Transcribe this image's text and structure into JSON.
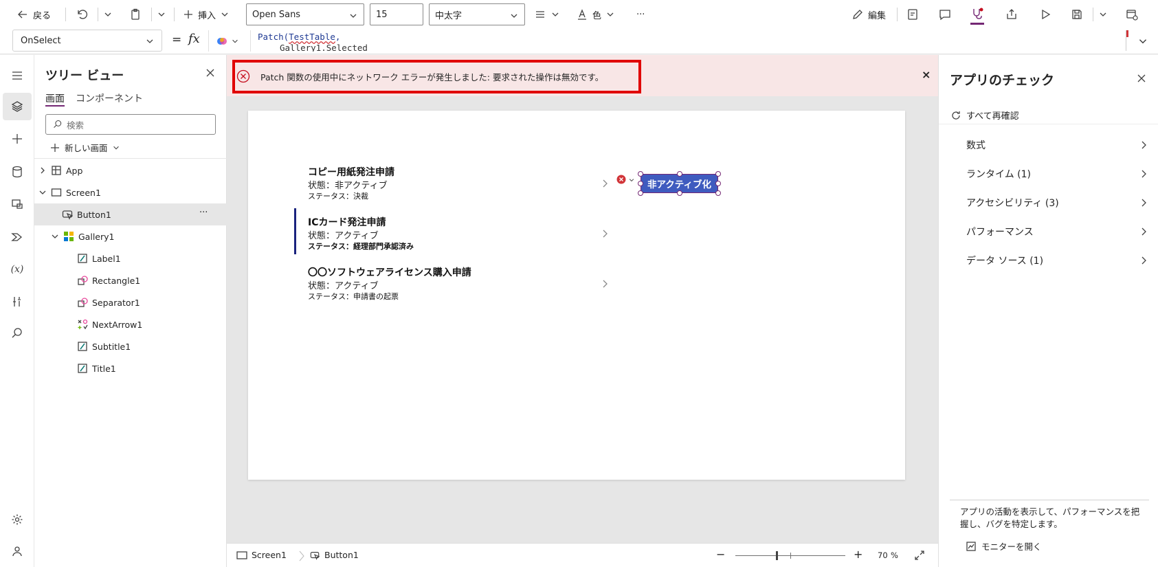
{
  "toolbar": {
    "back_label": "戻る",
    "insert_label": "挿入",
    "font_name": "Open Sans",
    "font_size": "15",
    "font_weight": "中太字",
    "color_label": "色",
    "more_label": "···",
    "edit_label": "編集"
  },
  "formula": {
    "property": "OnSelect",
    "equals": "=",
    "fx": "fx",
    "line1_fn": "Patch(",
    "line1_arg": "TestTable",
    "line1_comma": ",",
    "line2": "Gallery1.Selected"
  },
  "tree": {
    "title": "ツリー ビュー",
    "tab_screens": "画面",
    "tab_components": "コンポーネント",
    "search_placeholder": "検索",
    "new_screen_label": "新しい画面",
    "items": [
      {
        "label": "App"
      },
      {
        "label": "Screen1"
      },
      {
        "label": "Button1",
        "more": "···"
      },
      {
        "label": "Gallery1"
      },
      {
        "label": "Label1"
      },
      {
        "label": "Rectangle1"
      },
      {
        "label": "Separator1"
      },
      {
        "label": "NextArrow1"
      },
      {
        "label": "Subtitle1"
      },
      {
        "label": "Title1"
      }
    ]
  },
  "error_banner": {
    "message": "Patch 関数の使用中にネットワーク エラーが発生しました: 要求された操作は無効です。",
    "close": "×"
  },
  "gallery": {
    "items": [
      {
        "title": "コピー用紙発注申請",
        "subtitle": "状態：非アクティブ",
        "body": "ステータス：決裁"
      },
      {
        "title": "ICカード発注申請",
        "subtitle": "状態：アクティブ",
        "body": "ステータス：経理部門承認済み"
      },
      {
        "title": "〇〇ソフトウェアライセンス購入申請",
        "subtitle": "状態：アクティブ",
        "body": "ステータス：申請書の起票"
      }
    ],
    "button_label": "非アクティブ化"
  },
  "checker": {
    "title": "アプリのチェック",
    "recheck_label": "すべて再確認",
    "rows": [
      {
        "label": "数式"
      },
      {
        "label": "ランタイム (1)"
      },
      {
        "label": "アクセシビリティ (3)"
      },
      {
        "label": "パフォーマンス"
      },
      {
        "label": "データ ソース (1)"
      }
    ],
    "footer_text": "アプリの活動を表示して、パフォーマンスを把握し、バグを特定します。",
    "monitor_label": "モニターを開く"
  },
  "bottom": {
    "screen_crumb": "Screen1",
    "control_crumb": "Button1",
    "minus": "−",
    "plus": "+",
    "zoom": "70",
    "zoom_unit": "%"
  },
  "colors": {
    "accent": "#742774",
    "error_red": "#e00000",
    "banner_bg": "#f8e6e6",
    "button_blue": "#3f5bbf"
  }
}
